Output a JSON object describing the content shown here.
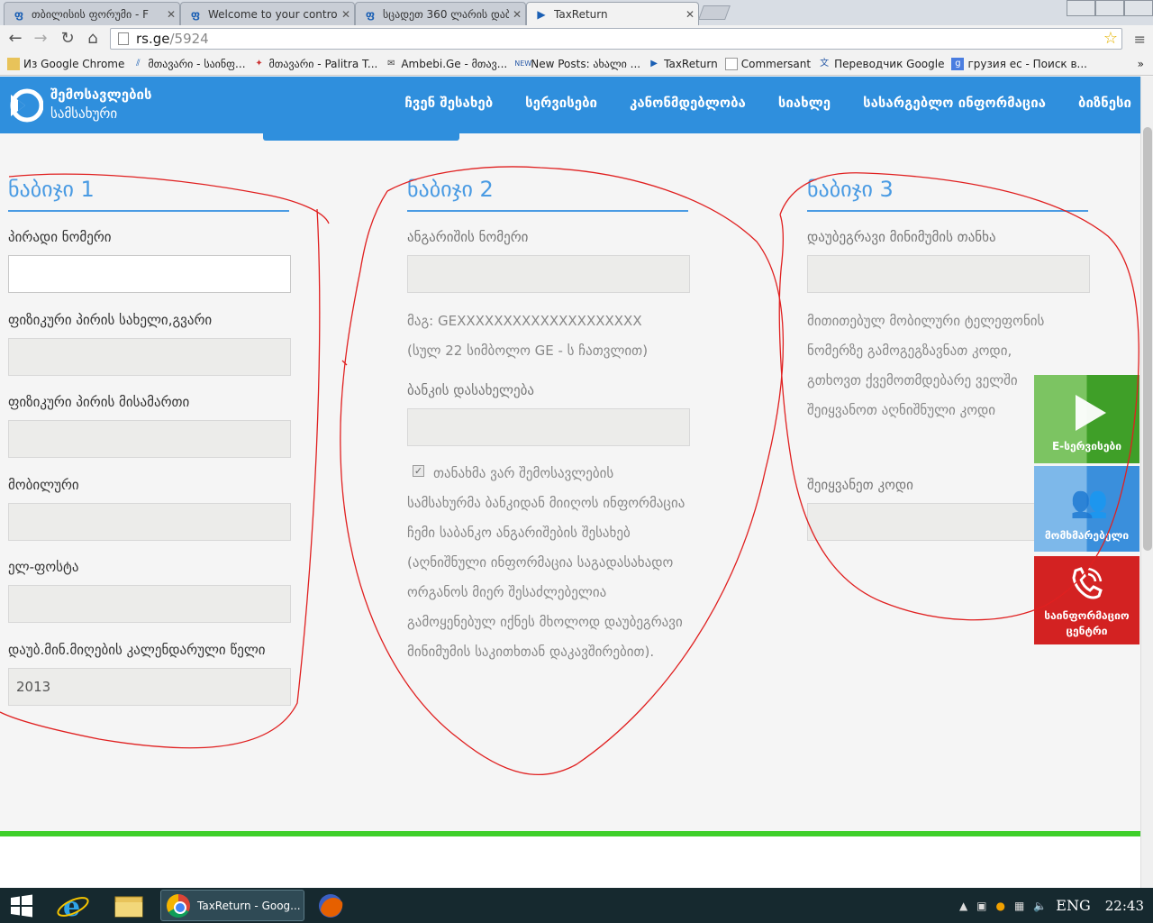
{
  "browser": {
    "tabs": [
      {
        "title": "თბილისის ფორუმი - F",
        "favicon": "ფ"
      },
      {
        "title": "Welcome to your control",
        "favicon": "ფ"
      },
      {
        "title": "სცადეთ 360 ლარის დაბ",
        "favicon": "ფ"
      },
      {
        "title": "TaxReturn",
        "favicon": "▶"
      }
    ],
    "url_host": "rs.ge",
    "url_path": "/5924",
    "bookmarks": [
      "Из Google Chrome",
      "მთავარი - საინფ...",
      "მთავარი - Palitra T...",
      "Ambebi.Ge - მთავ...",
      "New Posts: ახალი ...",
      "TaxReturn",
      "Commersant",
      "Переводчик Google",
      "грузия ес - Поиск в..."
    ],
    "bookmarks_more": "»"
  },
  "site": {
    "logo_line1": "შემოსავლების",
    "logo_line2": "სამსახური",
    "nav": [
      "ჩვენ შესახებ",
      "სერვისები",
      "კანონმდებლობა",
      "სიახლე",
      "სასარგებლო ინფორმაცია",
      "ბიზნესი"
    ]
  },
  "steps": {
    "step1": {
      "title": "ნაბიჯი 1",
      "fields": [
        {
          "label": "პირადი ნომერი",
          "value": ""
        },
        {
          "label": "ფიზიკური პირის სახელი,გვარი",
          "value": ""
        },
        {
          "label": "ფიზიკური პირის მისამართი",
          "value": ""
        },
        {
          "label": "მობილური",
          "value": ""
        },
        {
          "label": "ელ-ფოსტა",
          "value": ""
        },
        {
          "label": "დაუბ.მინ.მიღების კალენდარული წელი",
          "value": "2013"
        }
      ]
    },
    "step2": {
      "title": "ნაბიჯი 2",
      "account_label": "ანგარიშის ნომერი",
      "hint_example": "მაგ: GEXXXXXXXXXXXXXXXXXXXX",
      "hint_length": "(სულ 22 სიმბოლო GE - ს ჩათვლით)",
      "bank_label": "ბანკის დასახელება",
      "consent_checked": true,
      "consent_lines": [
        "თანახმა ვარ შემოსავლების",
        "სამსახურმა ბანკიდან მიიღოს ინფორმაცია",
        "ჩემი საბანკო ანგარიშების შესახებ",
        "(აღნიშნული ინფორმაცია საგადასახადო",
        "ორგანოს მიერ შესაძლებელია",
        "გამოყენებულ იქნეს მხოლოდ დაუბეგრავი",
        "მინიმუმის საკითხთან დაკავშირებით)."
      ]
    },
    "step3": {
      "title": "ნაბიჯი 3",
      "min_label": "დაუბეგრავი მინიმუმის თანხა",
      "info_lines": [
        "მითითებულ მობილური ტელეფონის",
        "ნომერზე გამოგეგზავნათ კოდი,",
        "გთხოვთ ქვემოთმდებარე ველში",
        "შეიყვანოთ აღნიშნული კოდი"
      ],
      "code_label": "შეიყვანეთ კოდი"
    }
  },
  "side_buttons": {
    "eservices": "E-სერვისები",
    "users": "მომხმარებელი",
    "info_line1": "საინფორმაციო",
    "info_line2": "ცენტრი"
  },
  "taskbar": {
    "chrome_label": "TaxReturn - Goog...",
    "lang": "ENG",
    "time": "22:43"
  },
  "colors": {
    "header_blue": "#2f8fdd",
    "step_title_blue": "#4a9be3",
    "footer_green": "#3ecf2a",
    "info_red": "#d32222",
    "eservice_green": "#3f9f28",
    "annotation_red": "#e02020"
  }
}
